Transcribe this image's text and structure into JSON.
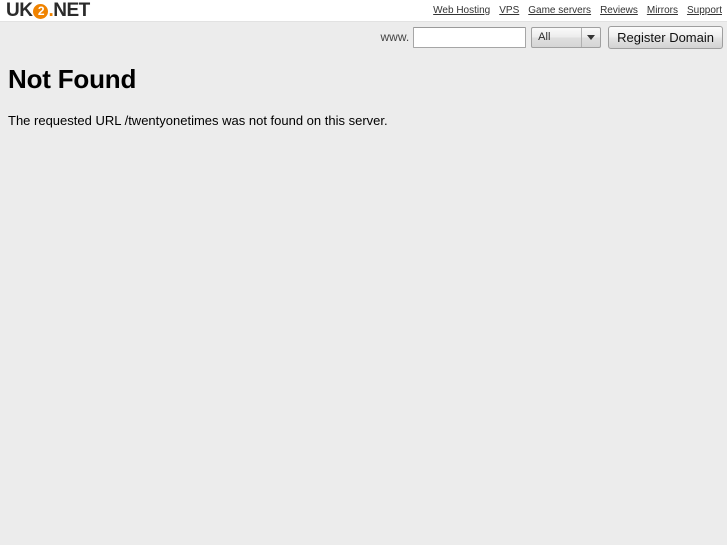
{
  "header": {
    "logo": {
      "prefix": "UK",
      "badge": "2",
      "dot": ".",
      "suffix": "NET",
      "accent_color": "#f08300"
    },
    "nav": [
      {
        "label": "Web Hosting",
        "name": "nav-link-web-hosting"
      },
      {
        "label": "VPS",
        "name": "nav-link-vps"
      },
      {
        "label": "Game servers",
        "name": "nav-link-game-servers"
      },
      {
        "label": "Reviews",
        "name": "nav-link-reviews"
      },
      {
        "label": "Mirrors",
        "name": "nav-link-mirrors"
      },
      {
        "label": "Support",
        "name": "nav-link-support"
      }
    ]
  },
  "search": {
    "www_label": "www.",
    "domain_value": "",
    "domain_placeholder": "",
    "tld_selected": "All",
    "tld_options": [
      "All"
    ],
    "register_label": "Register Domain"
  },
  "main": {
    "title": "Not Found",
    "message": "The requested URL /twentyonetimes was not found on this server."
  },
  "colors": {
    "page_background": "#ececec",
    "header_background": "#ffffff",
    "accent": "#f08300",
    "text": "#000000"
  }
}
